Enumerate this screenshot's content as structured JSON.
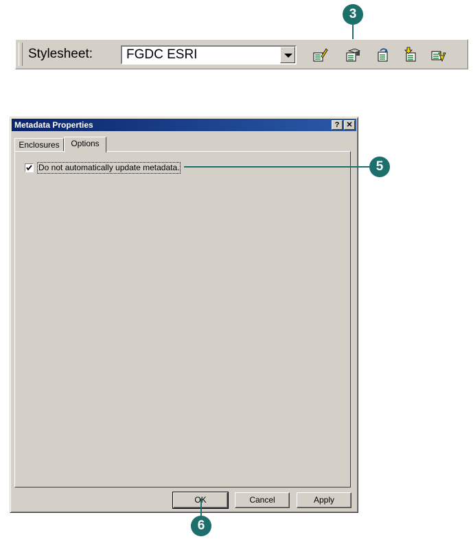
{
  "toolbar": {
    "label": "Stylesheet:",
    "stylesheet_value": "FGDC ESRI",
    "icons": [
      "edit-metadata-icon",
      "metadata-properties-icon",
      "create-update-metadata-icon",
      "import-metadata-icon",
      "export-metadata-icon"
    ]
  },
  "callouts": {
    "step3": "3",
    "step5": "5",
    "step6": "6"
  },
  "dialog": {
    "title": "Metadata Properties",
    "help_button": "?",
    "close_button": "✕",
    "tabs": [
      {
        "label": "Enclosures",
        "active": false
      },
      {
        "label": "Options",
        "active": true
      }
    ],
    "option_checkbox": {
      "label": "Do not automatically update metadata.",
      "checked": true
    },
    "buttons": {
      "ok": "OK",
      "cancel": "Cancel",
      "apply": "Apply"
    }
  },
  "colors": {
    "callout": "#1c6f6a",
    "titlebar": "#0a246a",
    "face": "#d4d0c8"
  }
}
